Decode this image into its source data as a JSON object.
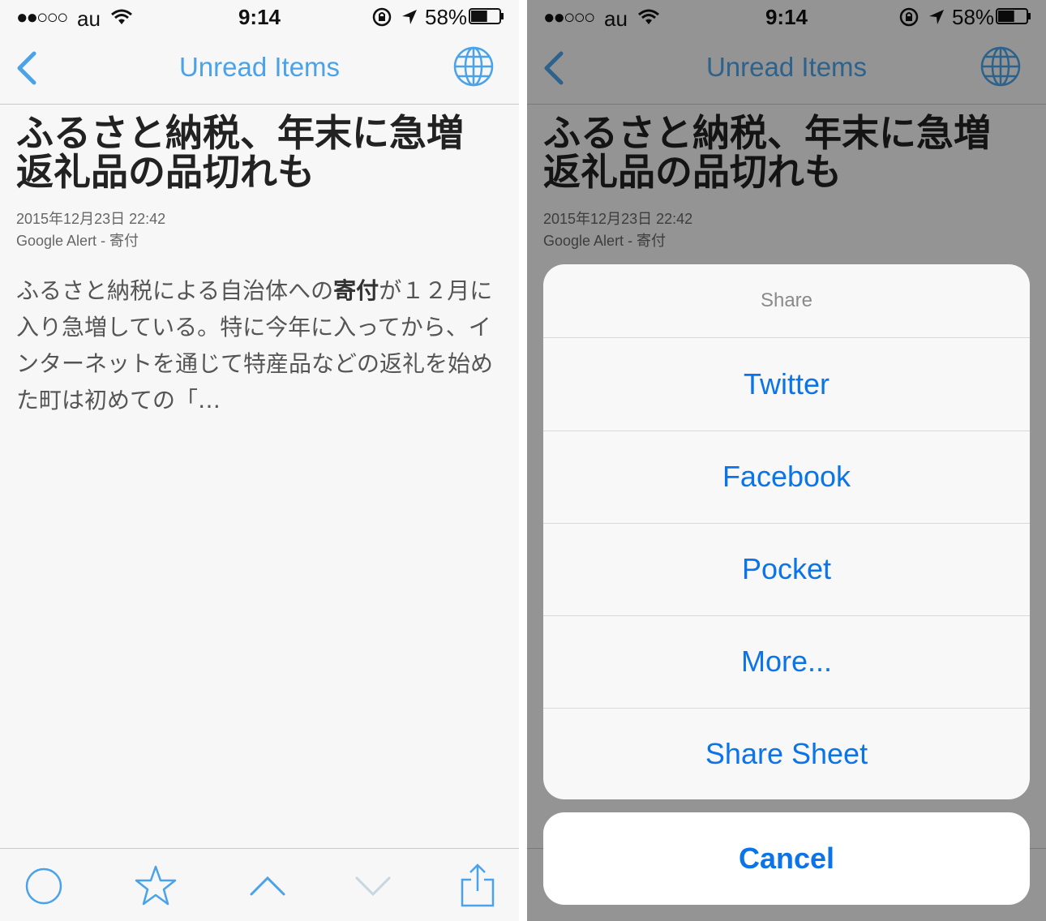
{
  "status_bar": {
    "signal": "●●○○○",
    "carrier": "au",
    "time": "9:14",
    "battery_pct": "58%",
    "battery_level": 0.58
  },
  "nav": {
    "title": "Unread Items"
  },
  "article": {
    "title_line1": "ふるさと納税、年末に急増",
    "title_line2": "返礼品の品切れも",
    "date": "2015年12月23日 22:42",
    "source": "Google Alert - 寄付",
    "body_before": "ふるさと納税による自治体への",
    "body_bold": "寄付",
    "body_after": "が１２月に入り急増している。特に今年に入ってから、インターネットを通じて特産品などの返礼を始めた町は初めての「…"
  },
  "share_sheet": {
    "title": "Share",
    "items": [
      "Twitter",
      "Facebook",
      "Pocket",
      "More...",
      "Share Sheet"
    ],
    "cancel": "Cancel"
  },
  "colors": {
    "accent": "#4aa3ea",
    "action": "#0a74e8"
  }
}
